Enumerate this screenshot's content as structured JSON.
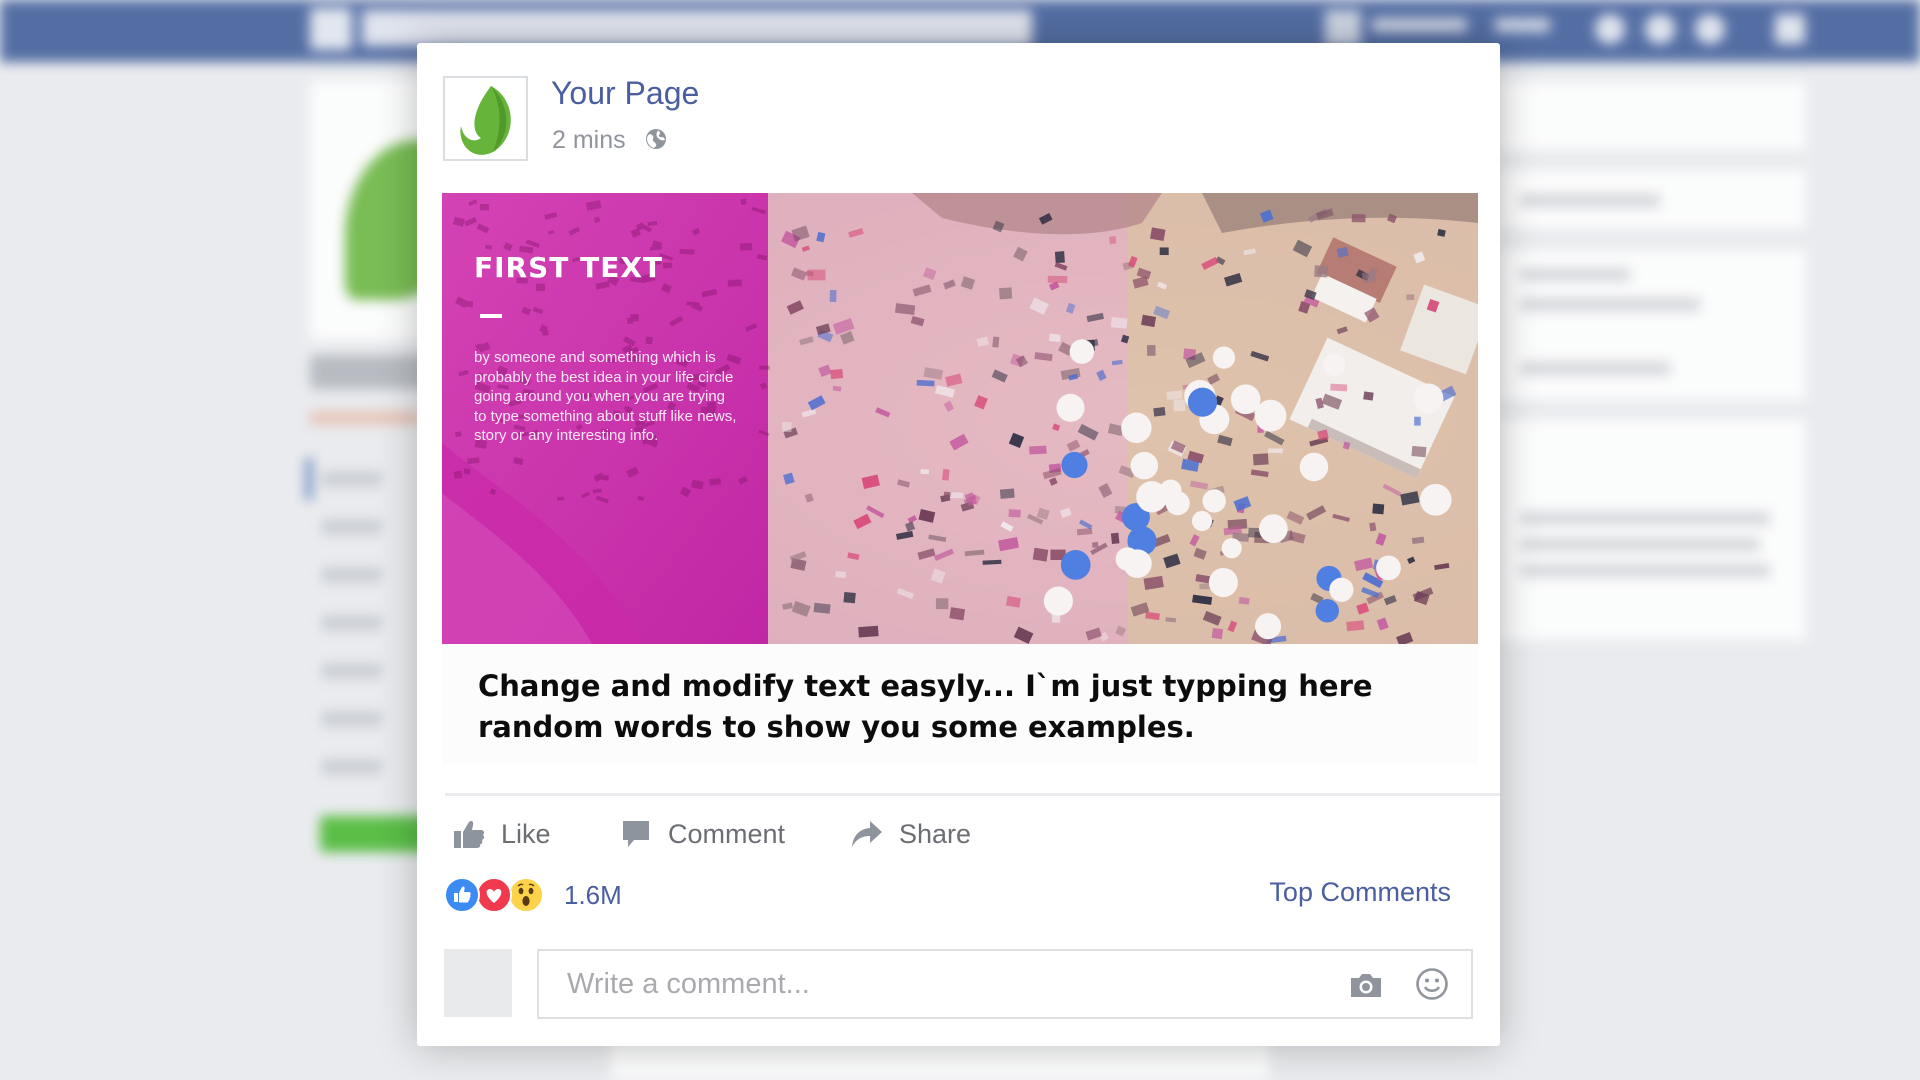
{
  "post": {
    "page_name": "Your Page",
    "time": "2 mins",
    "hero": {
      "title": "FIRST TEXT",
      "body": "by someone and something which is probably the best idea in your life circle going around you when you are trying to type something about stuff like news, story or any interesting info."
    },
    "caption": "Change and modify text easyly... I`m just typping here random words to show you some examples.",
    "actions": {
      "like": "Like",
      "comment": "Comment",
      "share": "Share"
    },
    "reactions": {
      "count": "1.6M",
      "types": [
        "like-reaction-icon",
        "love-reaction-icon",
        "wow-reaction-icon"
      ]
    },
    "top_comments": "Top Comments",
    "comment_placeholder": "Write a comment..."
  },
  "colors": {
    "facebook_blue": "#3b5998",
    "link_blue": "#4b5ea0",
    "magenta_overlay": "#d71fb2",
    "leaf_green": "#66b53a"
  }
}
